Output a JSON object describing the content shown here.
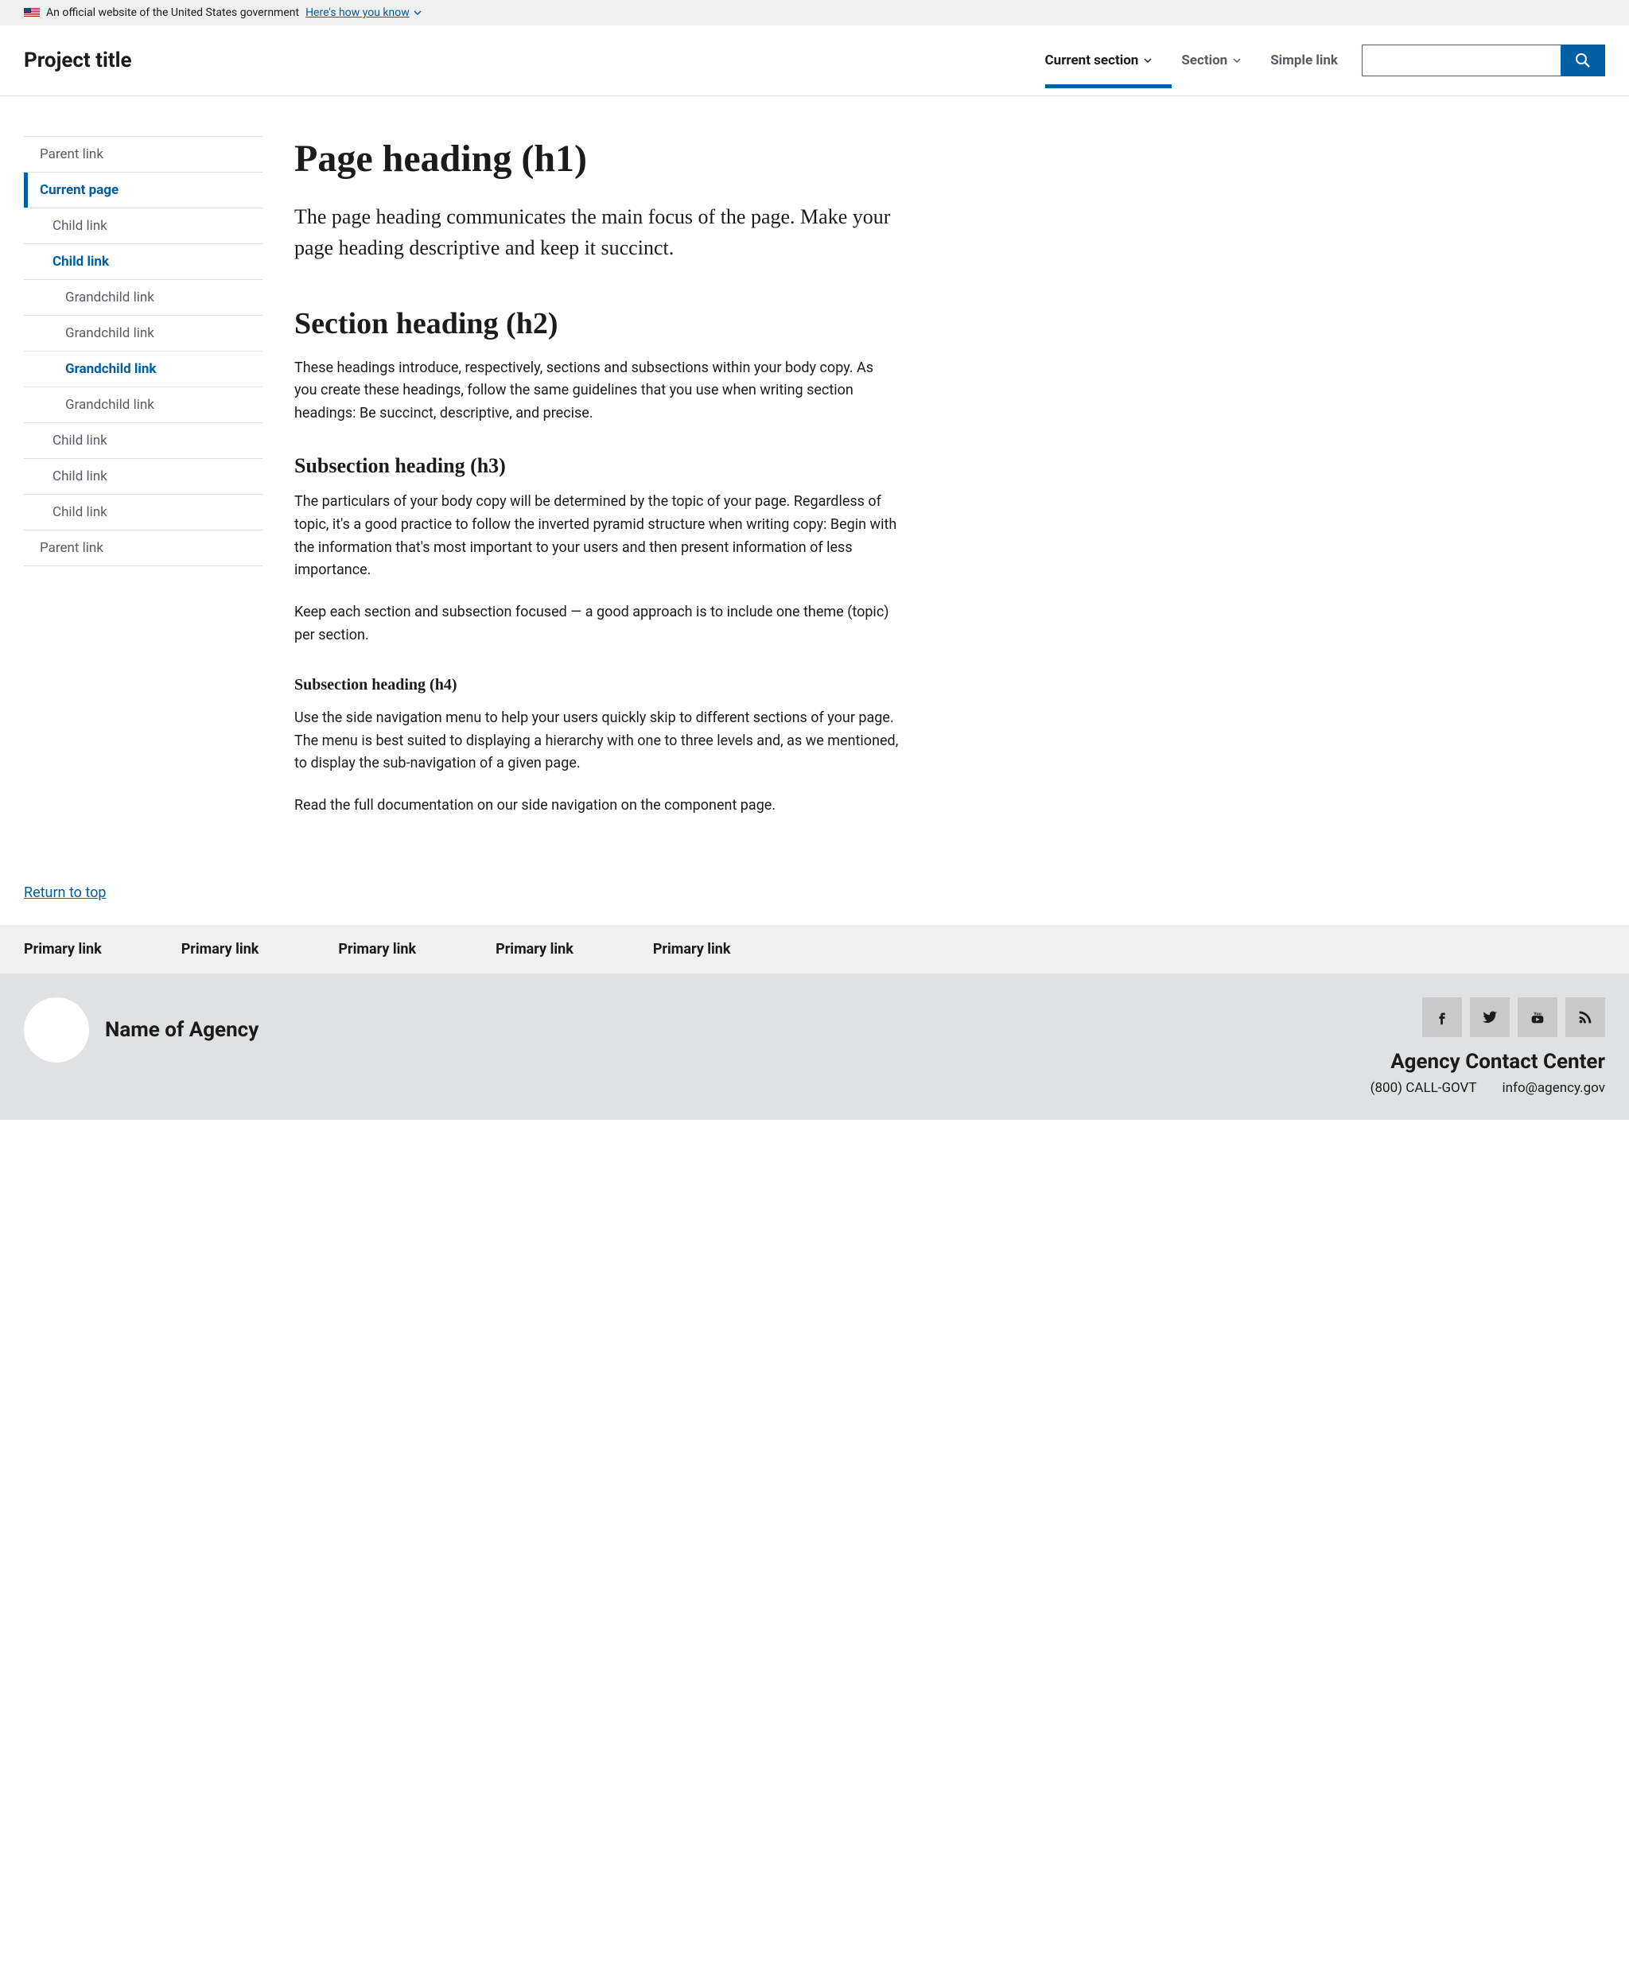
{
  "banner": {
    "text": "An official website of the United States government",
    "know": "Here's how you know"
  },
  "header": {
    "project_title": "Project title",
    "nav": [
      "Current section",
      "Section",
      "Simple link"
    ]
  },
  "sidenav": {
    "items": [
      {
        "label": "Parent link"
      },
      {
        "label": "Current page"
      },
      {
        "label": "Child link"
      },
      {
        "label": "Child link"
      },
      {
        "label": "Grandchild link"
      },
      {
        "label": "Grandchild link"
      },
      {
        "label": "Grandchild link"
      },
      {
        "label": "Grandchild link"
      },
      {
        "label": "Child link"
      },
      {
        "label": "Child link"
      },
      {
        "label": "Child link"
      },
      {
        "label": "Parent link"
      }
    ]
  },
  "content": {
    "h1": "Page heading (h1)",
    "intro": "The page heading communicates the main focus of the page. Make your page heading descriptive and keep it succinct.",
    "h2": "Section heading (h2)",
    "p1": "These headings introduce, respectively, sections and subsections within your body copy. As you create these headings, follow the same guidelines that you use when writing section headings: Be succinct, descriptive, and precise.",
    "h3": "Subsection heading (h3)",
    "p2": "The particulars of your body copy will be determined by the topic of your page. Regardless of topic, it's a good practice to follow the inverted pyramid structure when writing copy: Begin with the information that's most important to your users and then present information of less importance.",
    "p3": "Keep each section and subsection focused — a good approach is to include one theme (topic) per section.",
    "h4": "Subsection heading (h4)",
    "p4": "Use the side navigation menu to help your users quickly skip to different sections of your page. The menu is best suited to displaying a hierarchy with one to three levels and, as we mentioned, to display the sub-navigation of a given page.",
    "p5": "Read the full documentation on our side navigation on the component page."
  },
  "return_top": "Return to top",
  "footer": {
    "primary": [
      "Primary link",
      "Primary link",
      "Primary link",
      "Primary link",
      "Primary link"
    ],
    "agency_name": "Name of Agency",
    "contact_heading": "Agency Contact Center",
    "phone": "(800) CALL-GOVT",
    "email": "info@agency.gov"
  }
}
